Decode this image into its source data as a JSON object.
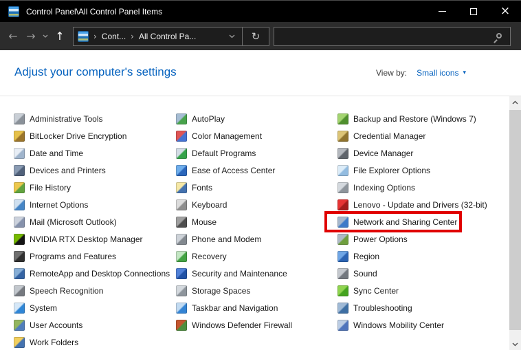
{
  "colors": {
    "titlebar_bg": "#000000",
    "navbar_bg": "#2c2c2c",
    "field_bg": "#1d1d1d",
    "field_border": "#6e6e6e",
    "link_blue": "#0763bf",
    "item_text": "#1a1a1a",
    "highlight_red": "#e00000"
  },
  "window": {
    "title": "Control Panel\\All Control Panel Items",
    "controls": {
      "minimize": "minimize",
      "maximize": "maximize",
      "close": "close"
    }
  },
  "navbar": {
    "back": "←",
    "forward": "→",
    "up": "↑",
    "refresh": "↻",
    "breadcrumb": {
      "root_icon": "control-panel-icon",
      "separator": "›",
      "items": [
        "Cont...",
        "All Control Pa..."
      ]
    },
    "search": {
      "value": "",
      "placeholder": ""
    }
  },
  "header": {
    "title": "Adjust your computer's settings",
    "view_by_label": "View by:",
    "view_by_value": "Small icons",
    "view_by_caret": "▾"
  },
  "highlight": {
    "item": "Network and Sharing Center",
    "color": "#e00000"
  },
  "columns": [
    {
      "items": [
        {
          "label": "Administrative Tools",
          "icon": "admin-tools",
          "c1": "#c9cfd6",
          "c2": "#8a9199"
        },
        {
          "label": "BitLocker Drive Encryption",
          "icon": "bitlocker-lock",
          "c1": "#e6c14a",
          "c2": "#9a742a"
        },
        {
          "label": "Date and Time",
          "icon": "date-time-clock",
          "c1": "#e8eef6",
          "c2": "#9fb4cc"
        },
        {
          "label": "Devices and Printers",
          "icon": "printer",
          "c1": "#8a9bb3",
          "c2": "#50617a"
        },
        {
          "label": "File History",
          "icon": "file-history",
          "c1": "#edc84e",
          "c2": "#61a33f"
        },
        {
          "label": "Internet Options",
          "icon": "internet-globe",
          "c1": "#cfe0f0",
          "c2": "#4585c6"
        },
        {
          "label": "Mail (Microsoft Outlook)",
          "icon": "mail",
          "c1": "#ccd2dd",
          "c2": "#8591ab"
        },
        {
          "label": "NVIDIA RTX Desktop Manager",
          "icon": "nvidia",
          "c1": "#76b900",
          "c2": "#141414"
        },
        {
          "label": "Programs and Features",
          "icon": "programs-disc",
          "c1": "#707070",
          "c2": "#303030"
        },
        {
          "label": "RemoteApp and Desktop Connections",
          "icon": "remoteapp",
          "c1": "#86aed6",
          "c2": "#3463a3"
        },
        {
          "label": "Speech Recognition",
          "icon": "microphone",
          "c1": "#c2c7cd",
          "c2": "#75797f"
        },
        {
          "label": "System",
          "icon": "system-monitor",
          "c1": "#d6e8f8",
          "c2": "#2f86d6"
        },
        {
          "label": "User Accounts",
          "icon": "user-accounts",
          "c1": "#93b65e",
          "c2": "#4f7dbb"
        },
        {
          "label": "Work Folders",
          "icon": "work-folders",
          "c1": "#f2cf5e",
          "c2": "#4472af"
        }
      ]
    },
    {
      "items": [
        {
          "label": "AutoPlay",
          "icon": "autoplay",
          "c1": "#a6bdd4",
          "c2": "#48a34c"
        },
        {
          "label": "Color Management",
          "icon": "color-management",
          "c1": "#df5555",
          "c2": "#4473d3"
        },
        {
          "label": "Default Programs",
          "icon": "default-programs",
          "c1": "#d4dde6",
          "c2": "#35a34a"
        },
        {
          "label": "Ease of Access Center",
          "icon": "ease-of-access",
          "c1": "#6faeec",
          "c2": "#2b66bb"
        },
        {
          "label": "Fonts",
          "icon": "fonts-letter",
          "c1": "#f6e8a6",
          "c2": "#4472af"
        },
        {
          "label": "Keyboard",
          "icon": "keyboard",
          "c1": "#dcdcdc",
          "c2": "#8e8e8e"
        },
        {
          "label": "Mouse",
          "icon": "mouse",
          "c1": "#a0a0a0",
          "c2": "#4e4e4e"
        },
        {
          "label": "Phone and Modem",
          "icon": "phone-modem",
          "c1": "#ced3d9",
          "c2": "#82888f"
        },
        {
          "label": "Recovery",
          "icon": "recovery-clock",
          "c1": "#c4e6c4",
          "c2": "#44a344"
        },
        {
          "label": "Security and Maintenance",
          "icon": "security-flag",
          "c1": "#5181d8",
          "c2": "#2253a6"
        },
        {
          "label": "Storage Spaces",
          "icon": "storage-stack",
          "c1": "#d4d9de",
          "c2": "#8e959c"
        },
        {
          "label": "Taskbar and Navigation",
          "icon": "taskbar",
          "c1": "#c2dbf2",
          "c2": "#3484d4"
        },
        {
          "label": "Windows Defender Firewall",
          "icon": "firewall-brick",
          "c1": "#c4562f",
          "c2": "#4e8f3e"
        }
      ]
    },
    {
      "items": [
        {
          "label": "Backup and Restore (Windows 7)",
          "icon": "backup-restore",
          "c1": "#a3d470",
          "c2": "#4f8f2d"
        },
        {
          "label": "Credential Manager",
          "icon": "credential-safe",
          "c1": "#dcc476",
          "c2": "#8f732d"
        },
        {
          "label": "Device Manager",
          "icon": "device-manager",
          "c1": "#b4b8be",
          "c2": "#5f646b"
        },
        {
          "label": "File Explorer Options",
          "icon": "file-explorer",
          "c1": "#dcecf8",
          "c2": "#93bce0"
        },
        {
          "label": "Indexing Options",
          "icon": "indexing-magnifier",
          "c1": "#d4d9de",
          "c2": "#8e959c"
        },
        {
          "label": "Lenovo - Update and Drivers (32-bit)",
          "icon": "lenovo-update",
          "c1": "#e63434",
          "c2": "#a31c1c"
        },
        {
          "label": "Network and Sharing Center",
          "icon": "network-sharing",
          "c1": "#a6b7cc",
          "c2": "#3e7ac8",
          "highlighted": true
        },
        {
          "label": "Power Options",
          "icon": "power-plug",
          "c1": "#aebac6",
          "c2": "#6f9f3e"
        },
        {
          "label": "Region",
          "icon": "region-globe",
          "c1": "#6fa6e6",
          "c2": "#2b63b3"
        },
        {
          "label": "Sound",
          "icon": "sound-speaker",
          "c1": "#c4c8ce",
          "c2": "#73787f"
        },
        {
          "label": "Sync Center",
          "icon": "sync-arrows",
          "c1": "#8fd44f",
          "c2": "#44a31f"
        },
        {
          "label": "Troubleshooting",
          "icon": "troubleshooting",
          "c1": "#a0bad6",
          "c2": "#3e6fa3"
        },
        {
          "label": "Windows Mobility Center",
          "icon": "mobility-center",
          "c1": "#bccde4",
          "c2": "#4f74bc"
        }
      ]
    }
  ]
}
